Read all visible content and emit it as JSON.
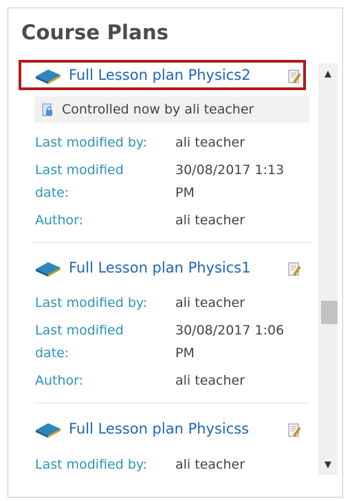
{
  "panel": {
    "title": "Course Plans"
  },
  "items": [
    {
      "title": "Full Lesson plan Physics2",
      "controlled_text": "Controlled now by ali teacher",
      "modified_by_label": "Last modified by:",
      "modified_by_value": "ali teacher",
      "modified_date_label_1": "Last modified",
      "modified_date_label_2": "date:",
      "modified_date_value_1": "30/08/2017 1:13",
      "modified_date_value_2": "PM",
      "author_label": "Author:",
      "author_value": "ali teacher"
    },
    {
      "title": "Full Lesson plan Physics1",
      "modified_by_label": "Last modified by:",
      "modified_by_value": "ali teacher",
      "modified_date_label_1": "Last modified",
      "modified_date_label_2": "date:",
      "modified_date_value_1": "30/08/2017 1:06",
      "modified_date_value_2": "PM",
      "author_label": "Author:",
      "author_value": "ali teacher"
    },
    {
      "title": "Full Lesson plan Physicss",
      "modified_by_label": "Last modified by:",
      "modified_by_value": "ali teacher"
    }
  ],
  "scrollbar": {
    "up_glyph": "▲",
    "down_glyph": "▼"
  },
  "colors": {
    "link": "#1c66b9",
    "label": "#2b93b8",
    "highlight": "#b11b1b"
  },
  "icons": {
    "book": "book-stack-icon",
    "edit": "edit-document-icon",
    "lock": "lock-document-icon"
  }
}
